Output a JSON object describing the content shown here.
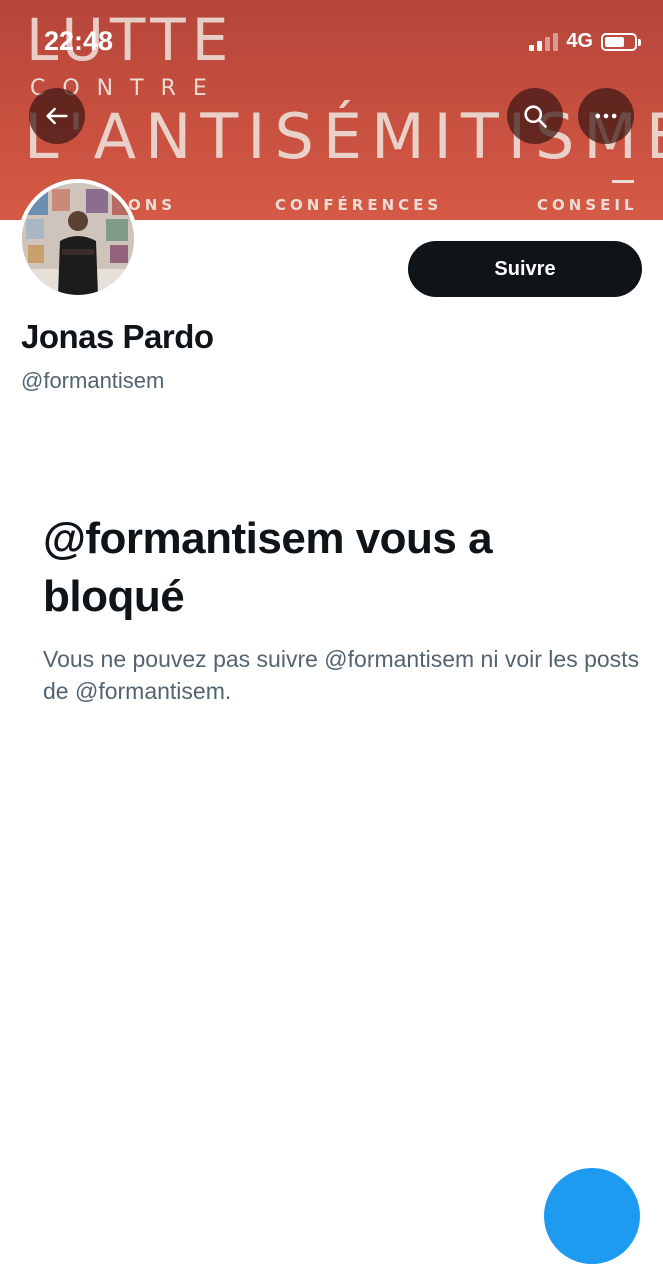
{
  "status_bar": {
    "time": "22:48",
    "network": "4G",
    "signal_bars_active": 2,
    "signal_bars_total": 4,
    "battery_level": 0.58
  },
  "banner": {
    "line1": "LUTTE",
    "line2": "CONTRE",
    "line3": "L'ANTISÉMITISME",
    "menu": [
      "ONS",
      "CONFÉRENCES",
      "CONSEIL"
    ],
    "color": "#c8503f"
  },
  "nav": {
    "back_icon": "arrow-left-icon",
    "search_icon": "search-icon",
    "more_icon": "more-horizontal-icon"
  },
  "profile": {
    "name": "Jonas Pardo",
    "handle": "@formantisem",
    "follow_label": "Suivre"
  },
  "blocked": {
    "title": "@formantisem vous a bloqué",
    "description": "Vous ne pouvez pas suivre @formantisem ni voir les posts de @formantisem."
  },
  "colors": {
    "primary_text": "#0f1419",
    "secondary_text": "#536471",
    "accent": "#1d9bf0"
  }
}
